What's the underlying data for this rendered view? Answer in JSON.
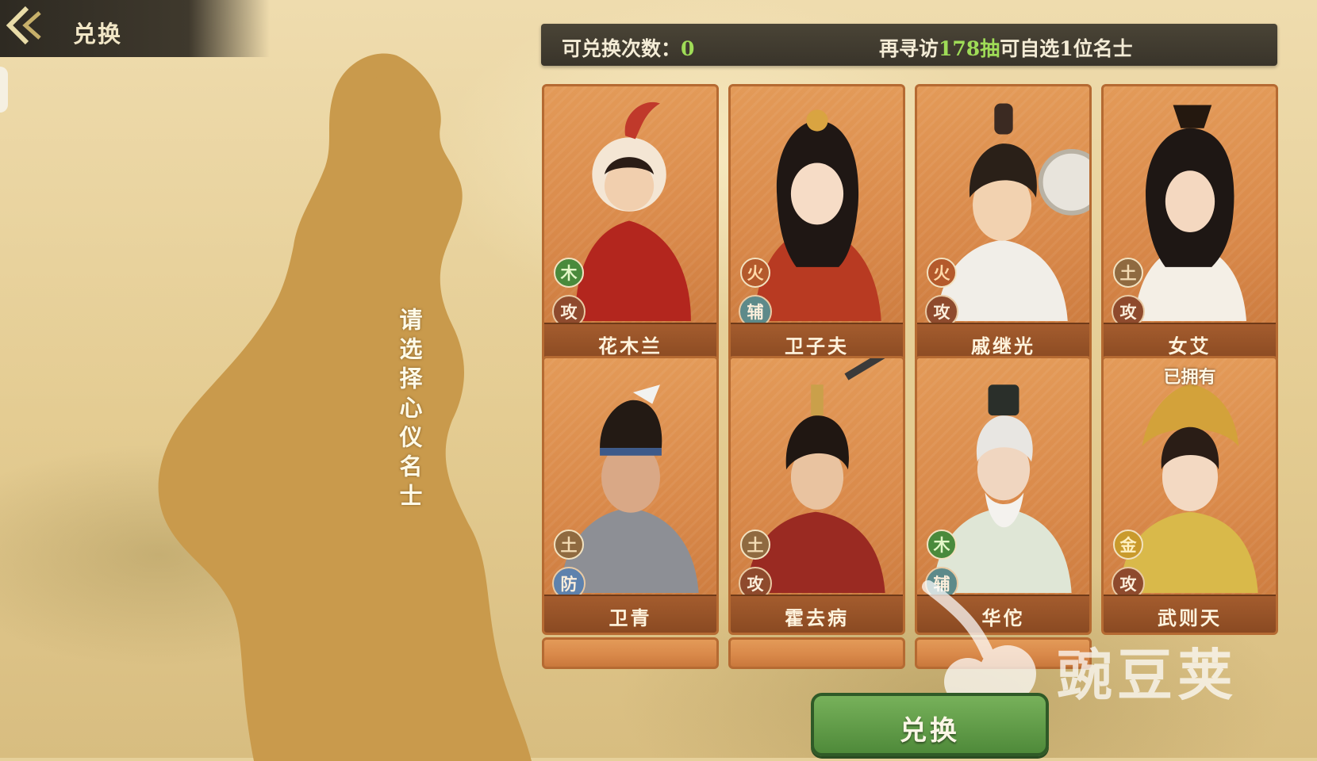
{
  "header": {
    "title": "兑换"
  },
  "prompt": {
    "text": "请选择心仪名士"
  },
  "info": {
    "count_label": "可兑换次数：",
    "count_value": "0",
    "visit_prefix": "再寻访",
    "visit_number": "178抽",
    "visit_suffix": "可自选1位名士"
  },
  "cards": [
    {
      "name": "花木兰",
      "element": "木",
      "role": "攻",
      "owned": ""
    },
    {
      "name": "卫子夫",
      "element": "火",
      "role": "辅",
      "owned": ""
    },
    {
      "name": "戚继光",
      "element": "火",
      "role": "攻",
      "owned": ""
    },
    {
      "name": "女艾",
      "element": "土",
      "role": "攻",
      "owned": ""
    },
    {
      "name": "卫青",
      "element": "土",
      "role": "防",
      "owned": ""
    },
    {
      "name": "霍去病",
      "element": "土",
      "role": "攻",
      "owned": ""
    },
    {
      "name": "华佗",
      "element": "木",
      "role": "辅",
      "owned": ""
    },
    {
      "name": "武则天",
      "element": "金",
      "role": "攻",
      "owned": "已拥有"
    }
  ],
  "exchange_button": {
    "label": "兑换"
  },
  "watermark": {
    "text": "豌豆荚"
  },
  "colors": {
    "accent_green": "#9fdc57",
    "card_orange": "#d9894a",
    "button_green": "#5f9a45"
  }
}
